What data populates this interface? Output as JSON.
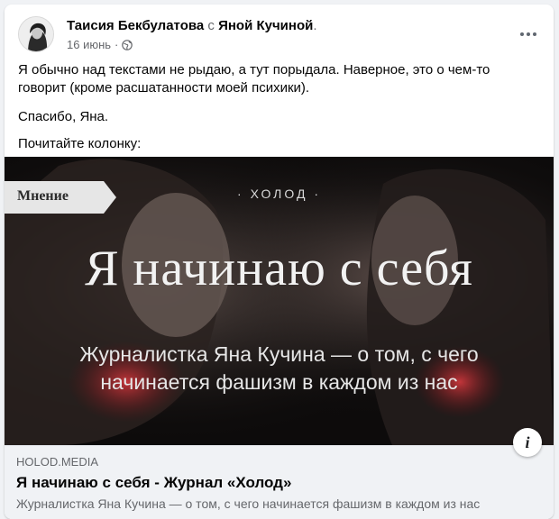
{
  "post": {
    "author_name": "Таисия Бекбулатова",
    "with_word": " с ",
    "with_name": "Яной Кучиной",
    "with_suffix": ".",
    "date": "16 июнь",
    "separator": "·",
    "privacy_icon": "globe-icon",
    "more_icon": "more-options-icon",
    "paragraphs": [
      "Я обычно над текстами не рыдаю, а тут порыдала. Наверное, это о чем-то говорит (кроме расшатанности моей психики).",
      "Спасибо, Яна.",
      "Почитайте колонку:"
    ]
  },
  "link": {
    "image": {
      "tag": "Мнение",
      "brand": "· ХОЛОД ·",
      "headline": "Я начинаю с себя",
      "subhead_line1": "Журналистка Яна Кучина — о том, с чего",
      "subhead_line2": "начинается фашизм в каждом из нас"
    },
    "info_label": "i",
    "domain": "HOLOD.MEDIA",
    "title": "Я начинаю с себя - Журнал «Холод»",
    "description": "Журналистка Яна Кучина — о том, с чего начинается фашизм в каждом из нас"
  }
}
